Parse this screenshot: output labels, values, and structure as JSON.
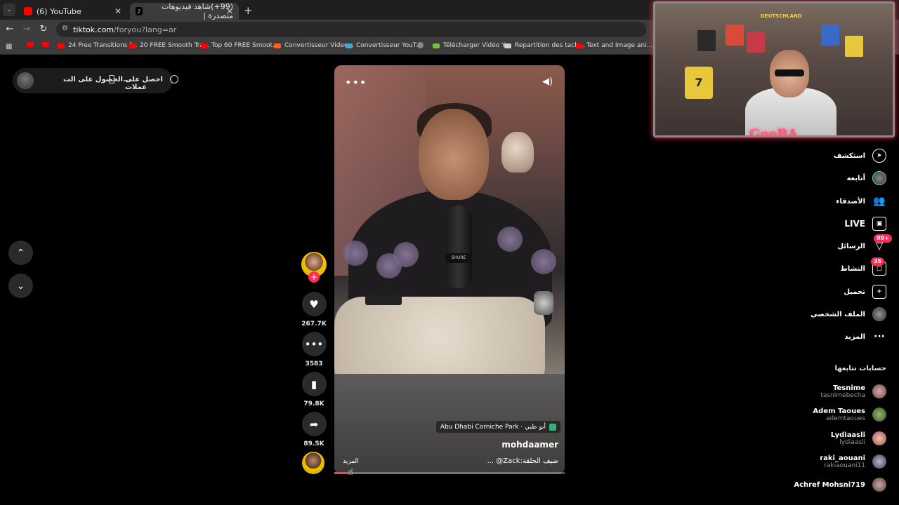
{
  "browser": {
    "tabs": [
      {
        "title": "(6) YouTube"
      },
      {
        "title": "(99+)شاهد فيديوهات متصدرة |"
      }
    ],
    "address": {
      "host": "tiktok.com",
      "path": "/foryou?lang=ar"
    },
    "bookmarks": [
      "24 Free Transitions f...",
      "20 FREE Smooth Tra...",
      "Top 60 FREE Smoot...",
      "Convertisseur Video...",
      "Convertisseur YouT...",
      "Télécharger Vidéo Y...",
      "Repartition des tach...",
      "Text and Image ani..."
    ]
  },
  "top_pill": {
    "coins_label": "احصل على عملات",
    "app_label": "الحصول على الت..."
  },
  "video": {
    "mic_brand": "SHURE",
    "location": "Abu Dhabi Corniche Park · أبو ظبي",
    "author": "mohdaamer",
    "caption": "ضيف الحلقة:Zack@ ...",
    "more_label": "المزيد",
    "progress": 0.06
  },
  "actions": {
    "likes": "267.7K",
    "comments": "3583",
    "saves": "79.8K",
    "shares": "89.5K"
  },
  "webcam": {
    "label": "GooBA",
    "shirt_number": "7",
    "banner": "DEUTSCHLAND"
  },
  "nav": {
    "items": [
      {
        "label": "استكشف"
      },
      {
        "label": "أتابعه"
      },
      {
        "label": "الأصدقاء"
      },
      {
        "label": "LIVE"
      },
      {
        "label": "الرسائل",
        "badge": "99+"
      },
      {
        "label": "النشاط",
        "badge": "35"
      },
      {
        "label": "تحميل"
      },
      {
        "label": "الملف الشخصي"
      },
      {
        "label": "المزيد"
      }
    ]
  },
  "following": {
    "title": "حسابات تتابعها",
    "accounts": [
      {
        "name": "Tesnime",
        "handle": "tasnimebecha"
      },
      {
        "name": "Adem Taoues",
        "handle": "ademtaoues"
      },
      {
        "name": "Lydiaasli",
        "handle": "lydiaasli"
      },
      {
        "name": "raki_aouani",
        "handle": "rakiaouani11"
      },
      {
        "name": "Achref Mohsni719",
        "handle": ""
      }
    ]
  }
}
